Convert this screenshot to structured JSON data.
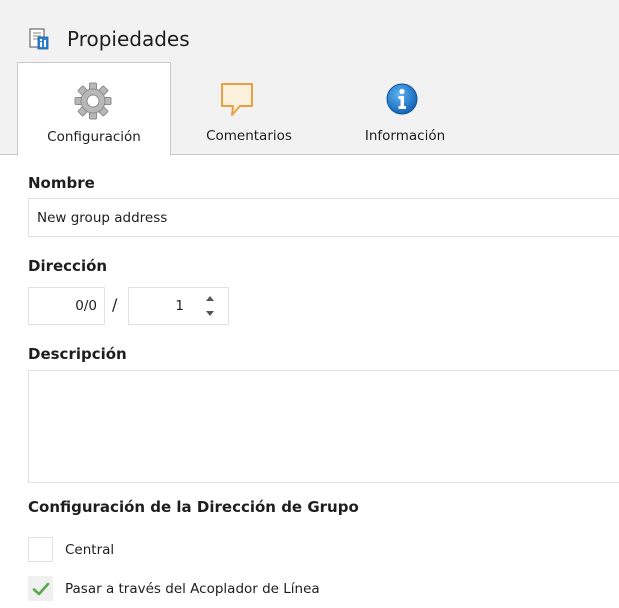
{
  "header": {
    "title": "Propiedades",
    "icon": "properties-document-icon"
  },
  "tabs": [
    {
      "label": "Configuración",
      "icon": "gear-icon",
      "active": true
    },
    {
      "label": "Comentarios",
      "icon": "comment-bubble-icon",
      "active": false
    },
    {
      "label": "Información",
      "icon": "info-icon",
      "active": false
    }
  ],
  "form": {
    "name_label": "Nombre",
    "name_value": "New group address",
    "address_label": "Dirección",
    "address_main": "0/0",
    "address_separator": "/",
    "address_sub": "1",
    "description_label": "Descripción",
    "description_value": "",
    "group_config_label": "Configuración de la Dirección de Grupo",
    "central_label": "Central",
    "central_checked": false,
    "pass_through_label": "Pasar a través del Acoplador de Línea",
    "pass_through_checked": true
  },
  "colors": {
    "header_bg": "#f2f2f2",
    "info_blue": "#1e88d2",
    "comment_orange": "#e8a040",
    "check_green": "#5aa84a"
  }
}
